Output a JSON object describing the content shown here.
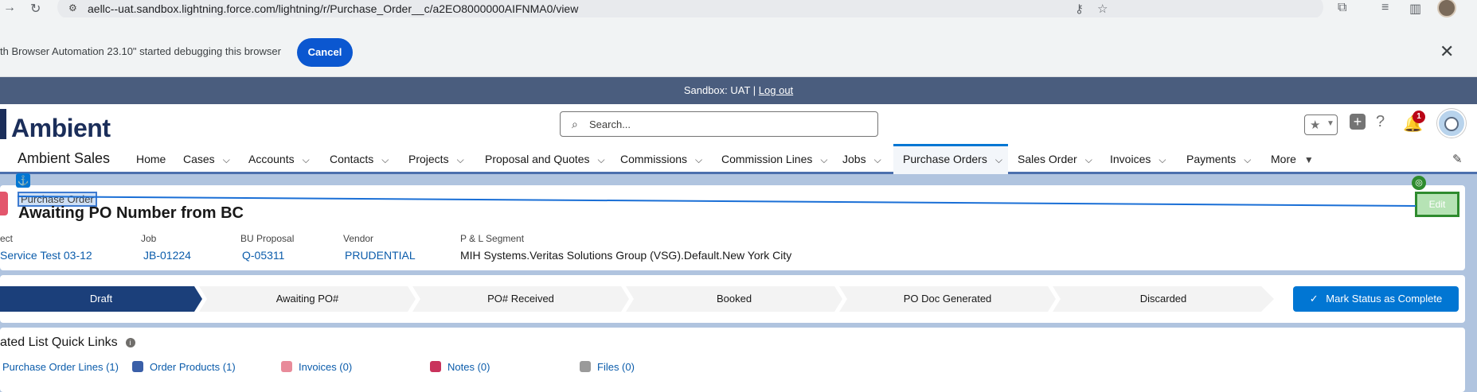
{
  "browser": {
    "url": "aellc--uat.sandbox.lightning.force.com/lightning/r/Purchase_Order__c/a2EO8000000AIFNMA0/view",
    "debug_message": "th Browser Automation 23.10\" started debugging this browser",
    "cancel_label": "Cancel",
    "close_glyph": "✕"
  },
  "sandbox_banner": {
    "text": "Sandbox: UAT |",
    "logout": "Log out"
  },
  "header": {
    "logo": "Ambient",
    "search_placeholder": "Search...",
    "notification_count": "1"
  },
  "nav": {
    "app_name": "Ambient Sales",
    "items": [
      {
        "label": "Home",
        "chevron": false
      },
      {
        "label": "Cases",
        "chevron": true
      },
      {
        "label": "Accounts",
        "chevron": true
      },
      {
        "label": "Contacts",
        "chevron": true
      },
      {
        "label": "Projects",
        "chevron": true
      },
      {
        "label": "Proposal and Quotes",
        "chevron": true
      },
      {
        "label": "Commissions",
        "chevron": true
      },
      {
        "label": "Commission Lines",
        "chevron": true
      },
      {
        "label": "Jobs",
        "chevron": true
      },
      {
        "label": "Purchase Orders",
        "chevron": true,
        "active": true
      },
      {
        "label": "Sales Order",
        "chevron": true
      },
      {
        "label": "Invoices",
        "chevron": true
      },
      {
        "label": "Payments",
        "chevron": true
      },
      {
        "label": "More",
        "chevron": true
      }
    ]
  },
  "record": {
    "object_label": "Purchase Order",
    "title": "Awaiting PO Number from BC",
    "edit_label": "Edit",
    "fields": [
      {
        "label": "ect",
        "value": "Service Test 03-12",
        "link": true
      },
      {
        "label": "Job",
        "value": "JB-01224",
        "link": true
      },
      {
        "label": "BU Proposal",
        "value": "Q-05311",
        "link": true
      },
      {
        "label": "Vendor",
        "value": "PRUDENTIAL",
        "link": true
      },
      {
        "label": "P & L Segment",
        "value": "MIH Systems.Veritas Solutions Group (VSG).Default.New York City",
        "link": false
      }
    ]
  },
  "path": {
    "stages": [
      "Draft",
      "Awaiting PO#",
      "PO# Received",
      "Booked",
      "PO Doc Generated",
      "Discarded"
    ],
    "current": "Draft",
    "mark_complete_label": "Mark Status as Complete"
  },
  "related": {
    "title": "ated List Quick Links",
    "links": [
      {
        "label": "Purchase Order Lines (1)",
        "color": "#ffffff"
      },
      {
        "label": "Order Products (1)",
        "color": "#3a5fa8"
      },
      {
        "label": "Invoices (0)",
        "color": "#e88b9a"
      },
      {
        "label": "Notes (0)",
        "color": "#c9335c"
      },
      {
        "label": "Files (0)",
        "color": "#9a9a9a"
      }
    ]
  },
  "colors": {
    "brand_nav": "#1b2e5a",
    "accent": "#0176d3",
    "path_current": "#1b3f7a"
  }
}
